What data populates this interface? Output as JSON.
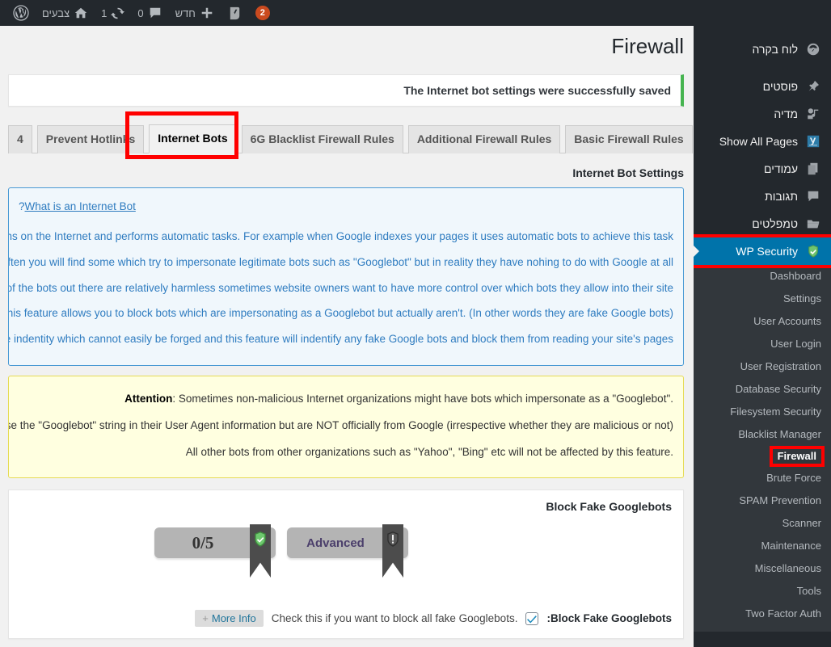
{
  "adminbar": {
    "wp_logo": "wordpress-logo-icon",
    "home_icon": "home-icon",
    "site_name": "צבעים",
    "updates_count": "1",
    "updates_icon": "updates-icon",
    "comments_count": "0",
    "comments_icon": "comment-icon",
    "new_label": "חדש",
    "new_icon": "plus-icon",
    "yoast_icon": "yoast-icon",
    "notification_count": "2"
  },
  "sidebar": {
    "items": [
      {
        "label": "לוח בקרה",
        "icon": "dashboard-icon",
        "name": "dashboard"
      },
      {
        "label": "פוסטים",
        "icon": "pin-icon",
        "name": "posts"
      },
      {
        "label": "מדיה",
        "icon": "media-icon",
        "name": "media"
      },
      {
        "label": "Show All Pages",
        "icon": "show-all-pages-icon",
        "name": "show-all-pages"
      },
      {
        "label": "עמודים",
        "icon": "pages-icon",
        "name": "pages"
      },
      {
        "label": "תגובות",
        "icon": "comments-icon",
        "name": "comments"
      },
      {
        "label": "טמפלטים",
        "icon": "templates-icon",
        "name": "templates"
      },
      {
        "label": "WP Security",
        "icon": "shield-icon",
        "name": "wp-security"
      }
    ],
    "submenu": [
      {
        "label": "Dashboard",
        "name": "dashboard"
      },
      {
        "label": "Settings",
        "name": "settings"
      },
      {
        "label": "User Accounts",
        "name": "user-accounts"
      },
      {
        "label": "User Login",
        "name": "user-login"
      },
      {
        "label": "User Registration",
        "name": "user-registration"
      },
      {
        "label": "Database Security",
        "name": "database-security"
      },
      {
        "label": "Filesystem Security",
        "name": "filesystem-security"
      },
      {
        "label": "Blacklist Manager",
        "name": "blacklist-manager"
      },
      {
        "label": "Firewall",
        "name": "firewall"
      },
      {
        "label": "Brute Force",
        "name": "brute-force"
      },
      {
        "label": "SPAM Prevention",
        "name": "spam-prevention"
      },
      {
        "label": "Scanner",
        "name": "scanner"
      },
      {
        "label": "Maintenance",
        "name": "maintenance"
      },
      {
        "label": "Miscellaneous",
        "name": "miscellaneous"
      },
      {
        "label": "Tools",
        "name": "tools"
      },
      {
        "label": "Two Factor Auth",
        "name": "two-factor-auth"
      }
    ]
  },
  "page": {
    "title": "Firewall",
    "notice": "The Internet bot settings were successfully saved",
    "section_heading": "Internet Bot Settings"
  },
  "tabs": [
    {
      "label": "4",
      "active": false
    },
    {
      "label": "Prevent Hotlinks",
      "active": false
    },
    {
      "label": "Internet Bots",
      "active": true
    },
    {
      "label": "6G Blacklist Firewall Rules",
      "active": false
    },
    {
      "label": "Additional Firewall Rules",
      "active": false
    },
    {
      "label": "Basic Firewall Rules",
      "active": false
    }
  ],
  "info_box": {
    "link_text": "What is an Internet Bot",
    "link_suffix": "?",
    "paragraphs": [
      "which runs on the Internet and performs automatic tasks. For example when Google indexes your pages it uses automatic bots to achieve this task",
      "od and often you will find some which try to impersonate legitimate bots such as \"Googlebot\" but in reality they have nohing to do with Google at all",
      "gh most of the bots out there are relatively harmless sometimes website owners want to have more control over which bots they allow into their site",
      "This feature allows you to block bots which are impersonating as a Googlebot but actually aren't. (In other words they are fake Google bots)",
      "a unique indentity which cannot easily be forged and this feature will indentify any fake Google bots and block them from reading your site's pages"
    ]
  },
  "attention_box": {
    "label": "Attention",
    "line1_prefix": ".\"",
    "line1": ": Sometimes non-malicious Internet organizations might have bots which impersonate as a \"Googlebot",
    "line2": "which use the \"Googlebot\" string in their User Agent information but are NOT officially from Google (irrespective whether they are malicious or not)",
    "line3": ".All other bots from other organizations such as \"Yahoo\", \"Bing\" etc will not be affected by this feature"
  },
  "panel": {
    "title": "Block Fake Googlebots",
    "badges": [
      {
        "value": "0/5",
        "icon": "shield-check-icon",
        "name": "score-badge"
      },
      {
        "value": "Advanced",
        "icon": "exclamation-shield-icon",
        "name": "difficulty-badge"
      }
    ],
    "setting": {
      "label": "Block Fake Googlebots:",
      "description": ".Check this if you want to block all fake Googlebots",
      "checked": true,
      "more_info_label": "More Info",
      "more_info_plus": "+"
    }
  },
  "colors": {
    "admin_bar": "#23282d",
    "sidebar": "#23282d",
    "submenu": "#32373c",
    "current_menu": "#0073aa",
    "highlight_red": "#ff0000",
    "notice_green": "#46b450",
    "info_blue": "#2f7cc0",
    "info_bg": "#f0f7fc",
    "attention_bg": "#ffffe0",
    "attention_border": "#e6db55",
    "link_blue": "#21759b"
  }
}
